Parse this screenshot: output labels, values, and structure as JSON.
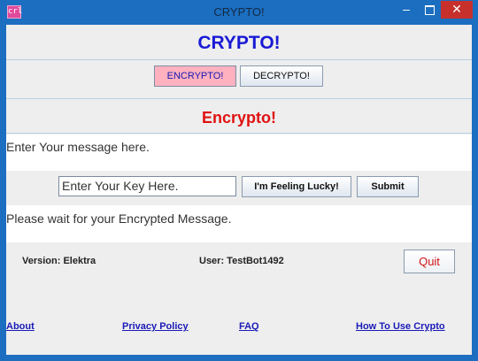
{
  "window": {
    "title": "CRYPTO!",
    "icon_label": "crl",
    "minimize_symbol": "–",
    "close_symbol": "✕"
  },
  "header": {
    "title": "CRYPTO!"
  },
  "mode": {
    "encrypt_label": "ENCRYPTO!",
    "decrypt_label": "DECRYPTO!"
  },
  "subtitle": "Encrypto!",
  "message": {
    "value": "Enter Your message here."
  },
  "key": {
    "value": "Enter Your Key Here.",
    "lucky_label": "I'm Feeling Lucky!",
    "submit_label": "Submit"
  },
  "output": {
    "value": "Please wait for your Encrypted Message."
  },
  "info": {
    "version": "Version: Elektra",
    "user": "User: TestBot1492",
    "quit_label": "Quit"
  },
  "links": {
    "about": "About",
    "privacy": "Privacy Policy",
    "faq": "FAQ",
    "howto": "How To Use Crypto"
  },
  "colors": {
    "titlebar": "#1c6ec0",
    "heading": "#1a1ad6",
    "subtitle": "#e01212",
    "encrypt_button": "#ffb1c0",
    "close_button": "#c7302b"
  }
}
